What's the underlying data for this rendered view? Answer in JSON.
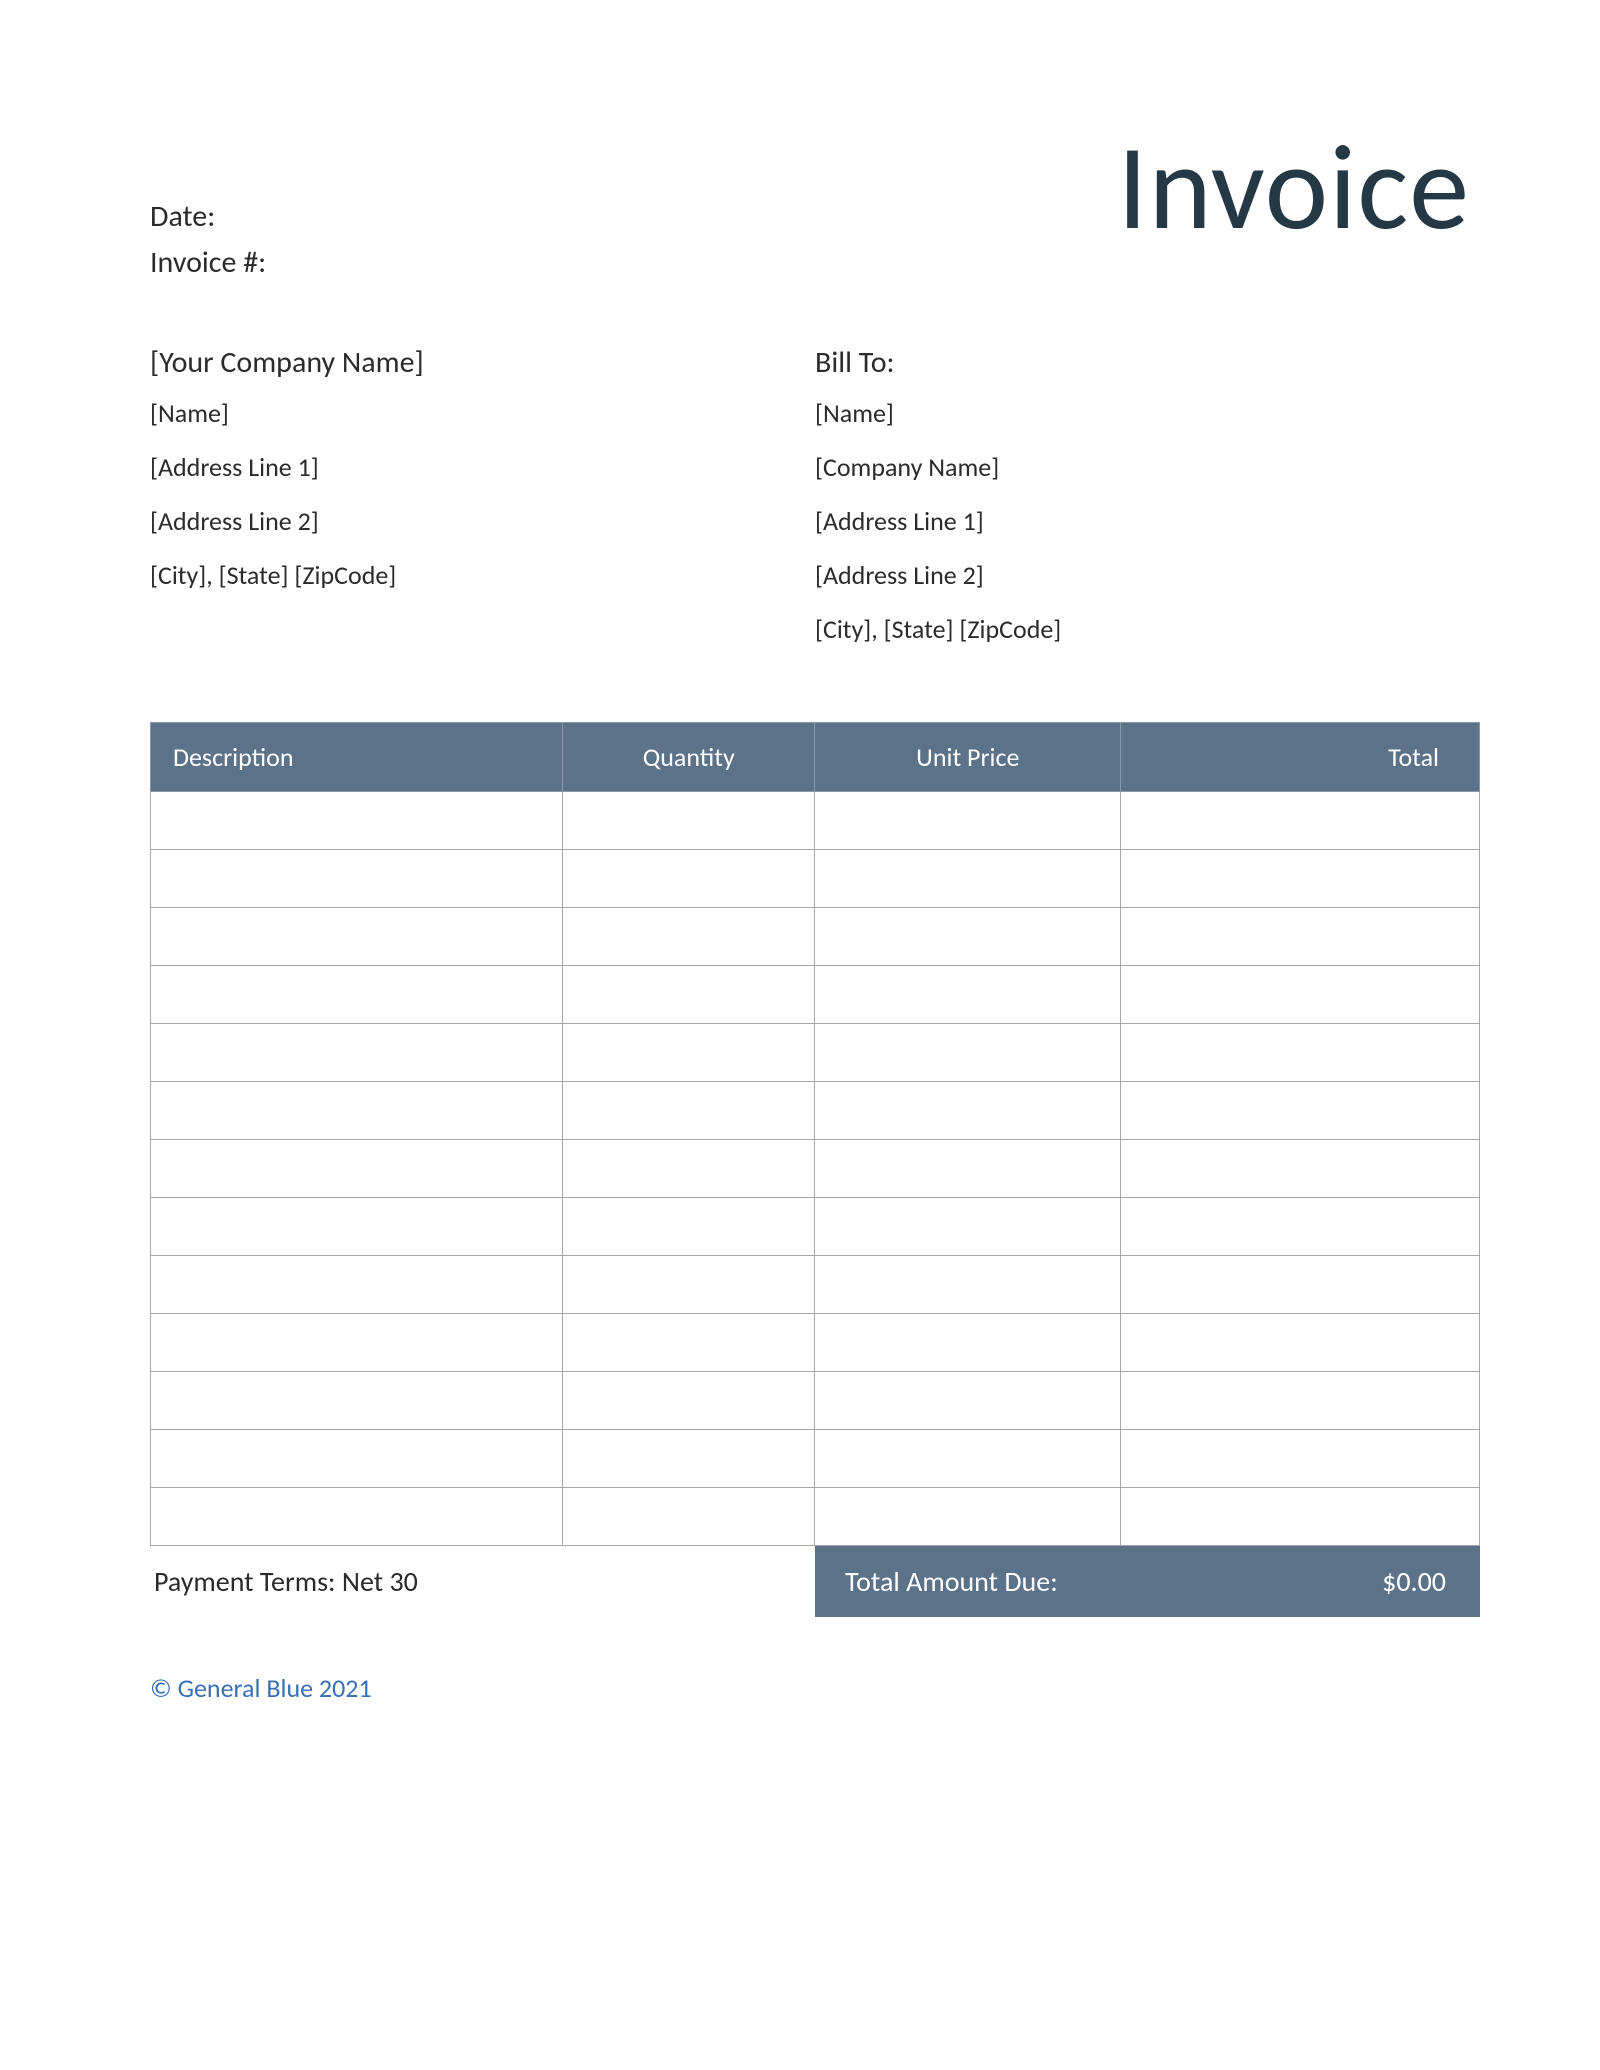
{
  "title": "Invoice",
  "meta": {
    "date_label": "Date:",
    "date_value": "",
    "invoice_no_label": "Invoice #:",
    "invoice_no_value": ""
  },
  "from": {
    "heading": "[Your Company Name]",
    "name": "[Name]",
    "address1": "[Address Line 1]",
    "address2": "[Address Line 2]",
    "city_state_zip": "[City], [State] [ZipCode]"
  },
  "bill_to": {
    "heading": "Bill To:",
    "name": "[Name]",
    "company": "[Company Name]",
    "address1": "[Address Line 1]",
    "address2": "[Address Line 2]",
    "city_state_zip": "[City], [State] [ZipCode]"
  },
  "table": {
    "headers": {
      "description": "Description",
      "quantity": "Quantity",
      "unit_price": "Unit Price",
      "total": "Total"
    },
    "rows": [
      {
        "description": "",
        "quantity": "",
        "unit_price": "",
        "total": ""
      },
      {
        "description": "",
        "quantity": "",
        "unit_price": "",
        "total": ""
      },
      {
        "description": "",
        "quantity": "",
        "unit_price": "",
        "total": ""
      },
      {
        "description": "",
        "quantity": "",
        "unit_price": "",
        "total": ""
      },
      {
        "description": "",
        "quantity": "",
        "unit_price": "",
        "total": ""
      },
      {
        "description": "",
        "quantity": "",
        "unit_price": "",
        "total": ""
      },
      {
        "description": "",
        "quantity": "",
        "unit_price": "",
        "total": ""
      },
      {
        "description": "",
        "quantity": "",
        "unit_price": "",
        "total": ""
      },
      {
        "description": "",
        "quantity": "",
        "unit_price": "",
        "total": ""
      },
      {
        "description": "",
        "quantity": "",
        "unit_price": "",
        "total": ""
      },
      {
        "description": "",
        "quantity": "",
        "unit_price": "",
        "total": ""
      },
      {
        "description": "",
        "quantity": "",
        "unit_price": "",
        "total": ""
      },
      {
        "description": "",
        "quantity": "",
        "unit_price": "",
        "total": ""
      }
    ]
  },
  "footer": {
    "payment_terms": "Payment Terms: Net 30",
    "total_due_label": "Total Amount Due:",
    "total_due_value": "$0.00"
  },
  "copyright": "© General Blue 2021"
}
